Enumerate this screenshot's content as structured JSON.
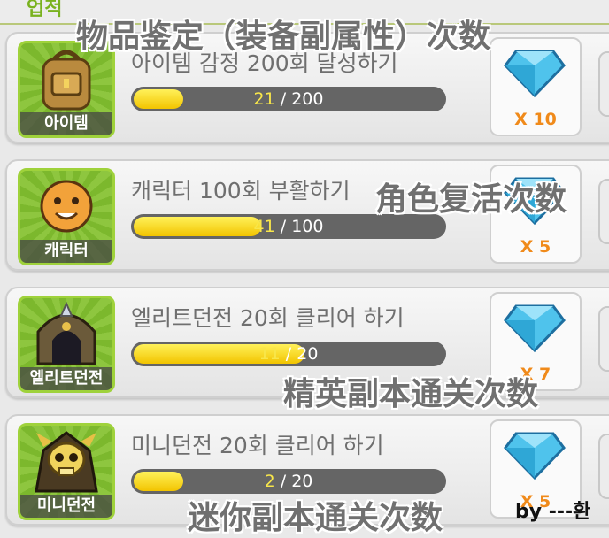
{
  "header": {
    "partial_label": "업적"
  },
  "achievements": [
    {
      "category": "아이템",
      "icon": "backpack-icon",
      "title": "아이템 감정 200회 달성하기",
      "current": "21",
      "total": "/ 200",
      "progress": 0.105,
      "reward": "X 10"
    },
    {
      "category": "캐릭터",
      "icon": "character-face-icon",
      "title": "캐릭터 100회 부활하기",
      "current": "41",
      "total": "/ 100",
      "progress": 0.41,
      "reward": "X 5"
    },
    {
      "category": "엘리트던전",
      "icon": "elite-dungeon-gate-icon",
      "title": "엘리트던전 20회 클리어 하기",
      "current": "11",
      "total": "/ 20",
      "progress": 0.55,
      "reward": "X 7"
    },
    {
      "category": "미니던전",
      "icon": "skull-icon",
      "title": "미니던전 20회 클리어 하기",
      "current": "2",
      "total": "/ 20",
      "progress": 0.1,
      "reward": "X 5"
    }
  ],
  "annotations": {
    "item_identify": "物品鉴定（装备副属性）次数",
    "revive": "角色复活次数",
    "elite": "精英副本通关次数",
    "mini": "迷你副本通关次数",
    "signature": "by ---환"
  },
  "colors": {
    "accent_green": "#8ec63f",
    "progress_yellow": "#f2c400",
    "reward_orange": "#f08a1a",
    "gem_blue": "#4fc3ec"
  }
}
